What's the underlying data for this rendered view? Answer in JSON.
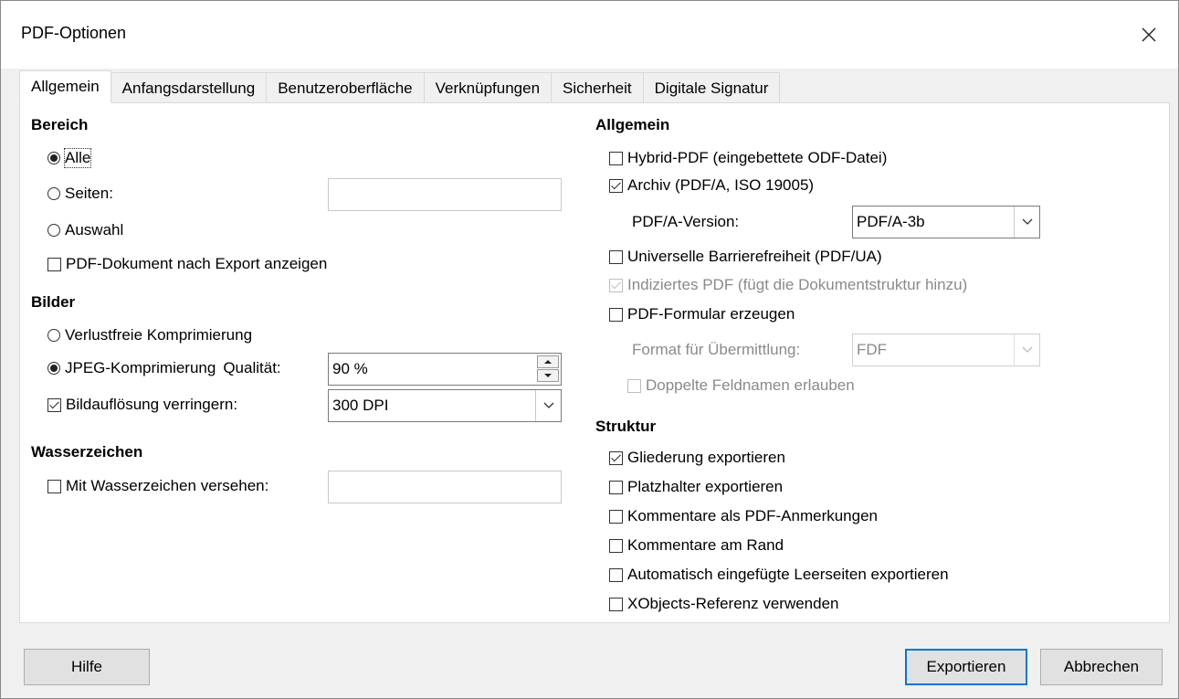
{
  "window": {
    "title": "PDF-Optionen"
  },
  "tabs": [
    {
      "label": "Allgemein",
      "active": true
    },
    {
      "label": "Anfangsdarstellung"
    },
    {
      "label": "Benutzeroberfläche"
    },
    {
      "label": "Verknüpfungen"
    },
    {
      "label": "Sicherheit"
    },
    {
      "label": "Digitale Signatur"
    }
  ],
  "left": {
    "range": {
      "heading": "Bereich",
      "all": {
        "label": "Alle",
        "checked": true
      },
      "pages": {
        "label": "Seiten:",
        "value": ""
      },
      "selection": {
        "label": "Auswahl"
      },
      "view_after_export": {
        "label": "PDF-Dokument nach Export anzeigen",
        "checked": false
      }
    },
    "images": {
      "heading": "Bilder",
      "lossless": {
        "label": "Verlustfreie Komprimierung"
      },
      "jpeg": {
        "label": "JPEG-Komprimierung",
        "quality_label": "Qualität:",
        "quality_value": "90 %",
        "checked": true
      },
      "reduce_resolution": {
        "label": "Bildauflösung verringern:",
        "checked": true,
        "value": "300 DPI"
      }
    },
    "watermark": {
      "heading": "Wasserzeichen",
      "sign": {
        "label": "Mit Wasserzeichen versehen:",
        "checked": false,
        "value": ""
      }
    }
  },
  "right": {
    "general": {
      "heading": "Allgemein",
      "hybrid": {
        "label": "Hybrid-PDF (eingebettete ODF-Datei)",
        "checked": false
      },
      "archive": {
        "label": "Archiv (PDF/A, ISO 19005)",
        "checked": true
      },
      "pdfa_version_label": "PDF/A-Version:",
      "pdfa_version_value": "PDF/A-3b",
      "ua": {
        "label": "Universelle Barrierefreiheit (PDF/UA)",
        "checked": false
      },
      "tagged": {
        "label": "Indiziertes PDF (fügt die Dokumentstruktur hinzu)",
        "checked": true,
        "disabled": true
      },
      "form": {
        "label": "PDF-Formular erzeugen",
        "checked": false
      },
      "submit_format_label": "Format für Übermittlung:",
      "submit_format_value": "FDF",
      "duplicate_fields": {
        "label": "Doppelte Feldnamen erlauben",
        "checked": false
      }
    },
    "structure": {
      "heading": "Struktur",
      "outline": {
        "label": "Gliederung exportieren",
        "checked": true
      },
      "placeholders": {
        "label": "Platzhalter exportieren",
        "checked": false
      },
      "comments_annotations": {
        "label": "Kommentare als PDF-Anmerkungen",
        "checked": false
      },
      "comments_margin": {
        "label": "Kommentare am Rand",
        "checked": false
      },
      "blank_pages": {
        "label": "Automatisch eingefügte Leerseiten exportieren",
        "checked": false
      },
      "xobjects": {
        "label": "XObjects-Referenz verwenden",
        "checked": false
      }
    }
  },
  "buttons": {
    "help": "Hilfe",
    "export": "Exportieren",
    "cancel": "Abbrechen"
  }
}
